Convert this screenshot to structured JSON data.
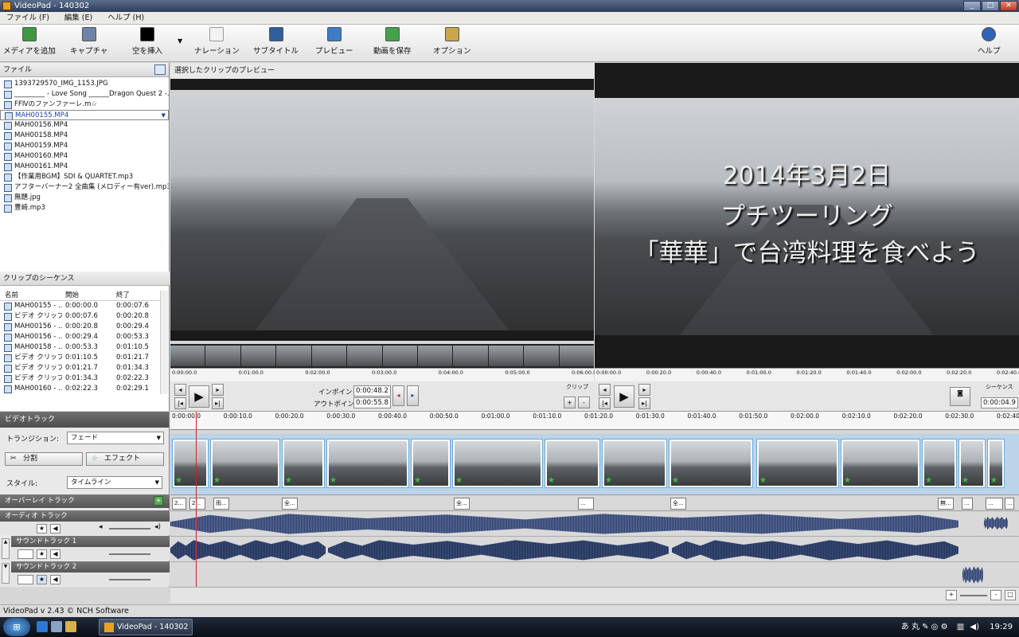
{
  "window": {
    "title": "VideoPad - 140302"
  },
  "menu": [
    "ファイル (F)",
    "編集 (E)",
    "ヘルプ (H)"
  ],
  "toolbar": {
    "add_media": "メディアを追加",
    "capture": "キャプチャ",
    "insert_blank": "空を挿入",
    "narration": "ナレーション",
    "subtitle": "サブタイトル",
    "preview": "プレビュー",
    "save_video": "動画を保存",
    "options": "オプション",
    "help": "ヘルプ"
  },
  "files": {
    "header": "ファイル",
    "items": [
      {
        "name": "1393729570_IMG_1153.JPG",
        "icon": "image-icon"
      },
      {
        "name": "_________ - Love Song ______Dragon Quest 2 -...",
        "icon": "audio-icon"
      },
      {
        "name": "FFⅣのファンファーレ.m☆",
        "icon": "audio-icon"
      },
      {
        "name": "MAH00155.MP4",
        "icon": "video-icon",
        "selected": true
      },
      {
        "name": "MAH00156.MP4",
        "icon": "video-icon"
      },
      {
        "name": "MAH00158.MP4",
        "icon": "video-icon"
      },
      {
        "name": "MAH00159.MP4",
        "icon": "video-icon"
      },
      {
        "name": "MAH00160.MP4",
        "icon": "video-icon"
      },
      {
        "name": "MAH00161.MP4",
        "icon": "video-icon"
      },
      {
        "name": "【作業用BGM】SDI & QUARTET.mp3",
        "icon": "audio-icon"
      },
      {
        "name": "アフターバーナー2 全曲集 (メロディー有ver).mp3",
        "icon": "audio-icon"
      },
      {
        "name": "無題.jpg",
        "icon": "image-icon"
      },
      {
        "name": "豊崎.mp3",
        "icon": "audio-icon"
      }
    ]
  },
  "sequence": {
    "header": "クリップのシーケンス",
    "columns": [
      "名前",
      "開始",
      "終了"
    ],
    "rows": [
      [
        "MAH00155 - ...",
        "0:00:00.0",
        "0:00:07.6"
      ],
      [
        "ビデオ クリップ 3",
        "0:00:07.6",
        "0:00:20.8"
      ],
      [
        "MAH00156 - ...",
        "0:00:20.8",
        "0:00:29.4"
      ],
      [
        "MAH00156 - ...",
        "0:00:29.4",
        "0:00:53.3"
      ],
      [
        "MAH00158 - ...",
        "0:00:53.3",
        "0:01:10.5"
      ],
      [
        "ビデオ クリップ 6",
        "0:01:10.5",
        "0:01:21.7"
      ],
      [
        "ビデオ クリップ 8",
        "0:01:21.7",
        "0:01:34.3"
      ],
      [
        "ビデオ クリップ 6",
        "0:01:34.3",
        "0:02:22.3"
      ],
      [
        "MAH00160 - ...",
        "0:02:22.3",
        "0:02:29.1"
      ]
    ]
  },
  "clip_preview": {
    "header": "選択したクリップのプレビュー",
    "tab": "クリップ",
    "in_label": "インポイント",
    "in_value": "0:00:48.2",
    "out_label": "アウトポイント",
    "out_value": "0:00:55.8",
    "ruler": [
      "0:00:00.0",
      "0:01:00.0",
      "0:02:00.0",
      "0:03:00.0",
      "0:04:00.0",
      "0:05:00.0",
      "0:06:00.0"
    ]
  },
  "seq_preview": {
    "tab": "シーケンス",
    "overlay_lines": [
      "2014年3月2日",
      "プチツーリング",
      "「華華」で台湾料理を食べよう"
    ],
    "time": "0:00:04.9",
    "ruler": [
      "0:00:00.0",
      "0:00:20.0",
      "0:00:40.0",
      "0:01:00.0",
      "0:01:20.0",
      "0:01:40.0",
      "0:02:00.0",
      "0:02:20.0",
      "0:02:40.0"
    ]
  },
  "timeline": {
    "ruler": [
      "0:00:00.0",
      "0:00:10.0",
      "0:00:20.0",
      "0:00:30.0",
      "0:00:40.0",
      "0:00:50.0",
      "0:01:00.0",
      "0:01:10.0",
      "0:01:20.0",
      "0:01:30.0",
      "0:01:40.0",
      "0:01:50.0",
      "0:02:00.0",
      "0:02:10.0",
      "0:02:20.0",
      "0:02:30.0",
      "0:02:40.0"
    ],
    "video_track": "ビデオトラック",
    "transition_label": "トランジション:",
    "transition_value": "フェード",
    "split_label": "分割",
    "effect_label": "エフェクト",
    "style_label": "スタイル:",
    "style_value": "タイムライン",
    "overlay_track": "オーバーレイ トラック",
    "audio_track": "オーディオ トラック",
    "sound_track_1": "サウンドトラック 1",
    "sound_track_2": "サウンドトラック 2",
    "title_clips": [
      "2...",
      "2...",
      "雨...",
      "全...",
      "全...",
      "...",
      "全...",
      "無...",
      "...",
      "...",
      "..."
    ]
  },
  "status": {
    "text": "VideoPad v 2.43 © NCH Software"
  },
  "taskbar": {
    "task": "VideoPad - 140302",
    "clock": "19:29"
  }
}
